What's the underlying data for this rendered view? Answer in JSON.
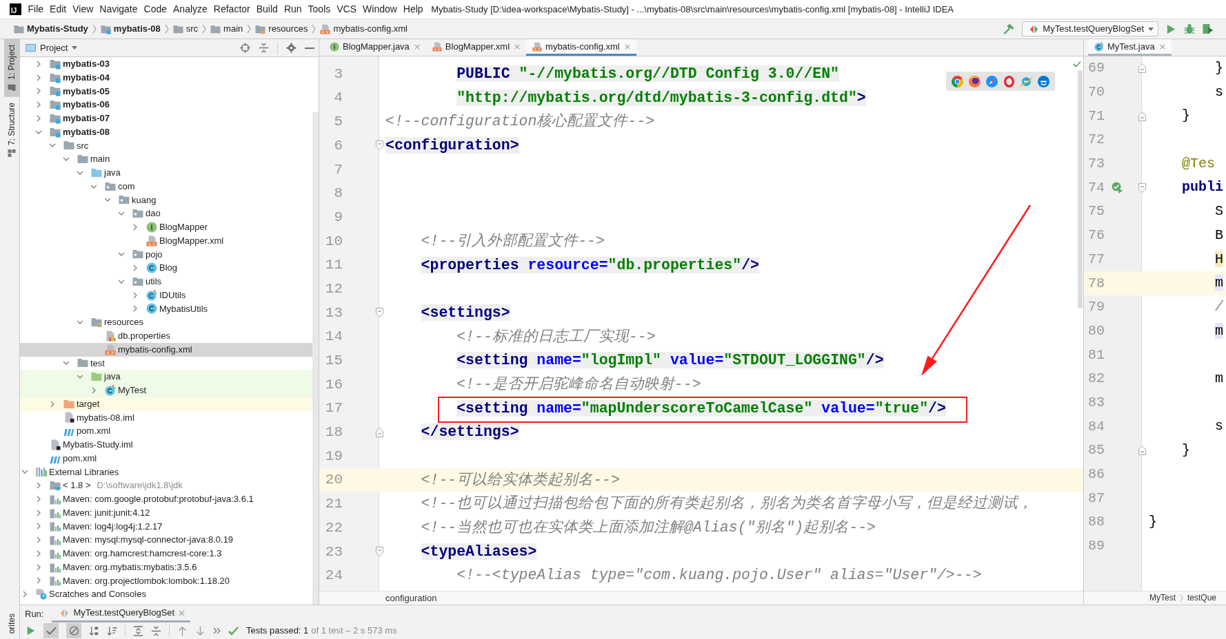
{
  "menu_bar": {
    "logo": "IJ",
    "items": [
      "File",
      "Edit",
      "View",
      "Navigate",
      "Code",
      "Analyze",
      "Refactor",
      "Build",
      "Run",
      "Tools",
      "VCS",
      "Window",
      "Help"
    ],
    "title": "Mybatis-Study [D:\\idea-workspace\\Mybatis-Study] - ...\\mybatis-08\\src\\main\\resources\\mybatis-config.xml [mybatis-08] - IntelliJ IDEA"
  },
  "navigation_bar": {
    "crumbs": [
      {
        "label": "Mybatis-Study",
        "kind": "project"
      },
      {
        "label": "mybatis-08",
        "kind": "module"
      },
      {
        "label": "src",
        "kind": "folder"
      },
      {
        "label": "main",
        "kind": "folder"
      },
      {
        "label": "resources",
        "kind": "resources"
      },
      {
        "label": "mybatis-config.xml",
        "kind": "xml"
      }
    ],
    "run_config": "MyTest.testQueryBlogSet"
  },
  "tool_stripe": {
    "tabs": [
      {
        "label": "1: Project",
        "kind": "project",
        "selected": true
      },
      {
        "label": "7: Structure",
        "kind": "structure",
        "selected": false
      }
    ],
    "bottom_tabs": [
      {
        "label": "orites",
        "selected": false
      }
    ]
  },
  "project_panel": {
    "title": "Project",
    "tree": {
      "project_children": [
        {
          "label": "mybatis-03",
          "kind": "module",
          "expanded": false,
          "selected": false
        },
        {
          "label": "mybatis-04",
          "kind": "module",
          "expanded": false,
          "selected": false
        },
        {
          "label": "mybatis-05",
          "kind": "module",
          "expanded": false,
          "selected": false
        },
        {
          "label": "mybatis-06",
          "kind": "module",
          "expanded": false,
          "selected": false
        },
        {
          "label": "mybatis-07",
          "kind": "module",
          "expanded": false,
          "selected": false
        },
        {
          "label": "mybatis-08",
          "kind": "module",
          "expanded": true,
          "selected": false,
          "children": [
            {
              "label": "src",
              "kind": "folder",
              "expanded": true,
              "selected": false,
              "children": [
                {
                  "label": "main",
                  "kind": "folder",
                  "expanded": true,
                  "selected": false,
                  "children": [
                    {
                      "label": "java",
                      "kind": "source_root",
                      "expanded": true,
                      "selected": false,
                      "children": [
                        {
                          "label": "com",
                          "kind": "package",
                          "expanded": true,
                          "selected": false,
                          "children": [
                            {
                              "label": "kuang",
                              "kind": "package",
                              "expanded": true,
                              "selected": false,
                              "children": [
                                {
                                  "label": "dao",
                                  "kind": "package",
                                  "expanded": true,
                                  "selected": false,
                                  "children": [
                                    {
                                      "label": "BlogMapper",
                                      "kind": "interface",
                                      "expanded": false,
                                      "selected": false
                                    },
                                    {
                                      "label": "BlogMapper.xml",
                                      "kind": "xml",
                                      "selected": false
                                    }
                                  ]
                                },
                                {
                                  "label": "pojo",
                                  "kind": "package",
                                  "expanded": true,
                                  "selected": false,
                                  "children": [
                                    {
                                      "label": "Blog",
                                      "kind": "class",
                                      "expanded": false,
                                      "selected": false
                                    }
                                  ]
                                },
                                {
                                  "label": "utils",
                                  "kind": "package",
                                  "expanded": true,
                                  "selected": false,
                                  "children": [
                                    {
                                      "label": "IDUtils",
                                      "kind": "class_mod",
                                      "expanded": false,
                                      "selected": false
                                    },
                                    {
                                      "label": "MybatisUtils",
                                      "kind": "class",
                                      "expanded": false,
                                      "selected": false
                                    }
                                  ]
                                }
                              ]
                            }
                          ]
                        }
                      ]
                    },
                    {
                      "label": "resources",
                      "kind": "resources",
                      "expanded": true,
                      "selected": false,
                      "children": [
                        {
                          "label": "db.properties",
                          "kind": "properties",
                          "selected": false
                        },
                        {
                          "label": "mybatis-config.xml",
                          "kind": "xml",
                          "selected": true
                        }
                      ]
                    }
                  ]
                },
                {
                  "label": "test",
                  "kind": "folder",
                  "expanded": true,
                  "selected": false,
                  "children": [
                    {
                      "label": "java",
                      "kind": "test_root",
                      "expanded": true,
                      "selected": false,
                      "children": [
                        {
                          "label": "MyTest",
                          "kind": "class_mod",
                          "expanded": false,
                          "selected": false
                        }
                      ]
                    }
                  ]
                }
              ]
            },
            {
              "label": "target",
              "kind": "excluded",
              "expanded": false,
              "selected": false
            },
            {
              "label": "mybatis-08.iml",
              "kind": "iml",
              "selected": false
            },
            {
              "label": "pom.xml",
              "kind": "maven",
              "selected": false
            }
          ]
        },
        {
          "label": "Mybatis-Study.iml",
          "kind": "iml",
          "selected": false
        },
        {
          "label": "pom.xml",
          "kind": "maven",
          "selected": false
        }
      ],
      "roots": [
        {
          "label": "External Libraries",
          "kind": "libraries",
          "expanded": true,
          "selected": false,
          "children": [
            {
              "label": "< 1.8 >",
              "detail": "D:\\software\\jdk1.8\\jdk",
              "kind": "jdk",
              "expanded": false,
              "selected": false
            },
            {
              "label": "Maven: com.google.protobuf:protobuf-java:3.6.1",
              "kind": "library",
              "expanded": false,
              "selected": false
            },
            {
              "label": "Maven: junit:junit:4.12",
              "kind": "library",
              "expanded": false,
              "selected": false
            },
            {
              "label": "Maven: log4j:log4j:1.2.17",
              "kind": "library",
              "expanded": false,
              "selected": false
            },
            {
              "label": "Maven: mysql:mysql-connector-java:8.0.19",
              "kind": "library",
              "expanded": false,
              "selected": false
            },
            {
              "label": "Maven: org.hamcrest:hamcrest-core:1.3",
              "kind": "library",
              "expanded": false,
              "selected": false
            },
            {
              "label": "Maven: org.mybatis:mybatis:3.5.6",
              "kind": "library",
              "expanded": false,
              "selected": false
            },
            {
              "label": "Maven: org.projectlombok:lombok:1.18.20",
              "kind": "library",
              "expanded": false,
              "selected": false
            }
          ]
        },
        {
          "label": "Scratches and Consoles",
          "kind": "scratches",
          "expanded": false,
          "selected": false
        }
      ]
    }
  },
  "editor": {
    "focused": true,
    "arrow": true,
    "tabs": [
      {
        "label": "BlogMapper.java",
        "kind": "interface",
        "selected": false
      },
      {
        "label": "BlogMapper.xml",
        "kind": "xml",
        "selected": false
      },
      {
        "label": "mybatis-config.xml",
        "kind": "xml",
        "selected": true
      }
    ],
    "lines": [
      {
        "number": "3",
        "tokens": [
          {
            "kind": "doctype",
            "text": "        PUBLIC"
          },
          {
            "kind": "value",
            "text": " \"-//mybatis.org//DTD Config 3.0//EN\""
          }
        ],
        "current": false,
        "boxed": false
      },
      {
        "number": "4",
        "tokens": [
          {
            "kind": "value",
            "text": "        \"http://mybatis.org/dtd/mybatis-3-config.dtd\""
          },
          {
            "kind": "tag",
            "text": ">"
          }
        ],
        "current": false,
        "boxed": false
      },
      {
        "number": "5",
        "tokens": [
          {
            "kind": "comment",
            "text": "<!--configuration核心配置文件-->"
          }
        ],
        "current": false,
        "boxed": false
      },
      {
        "number": "6",
        "tokens": [
          {
            "kind": "tag",
            "text": "<configuration>"
          }
        ],
        "gutter": [
          {
            "kind": "fold_start"
          }
        ],
        "current": false,
        "boxed": false
      },
      {
        "number": "7",
        "current": false,
        "boxed": false
      },
      {
        "number": "8",
        "current": false,
        "boxed": false
      },
      {
        "number": "9",
        "current": false,
        "boxed": false
      },
      {
        "number": "10",
        "tokens": [
          {
            "kind": "comment",
            "text": "    <!--引入外部配置文件-->"
          }
        ],
        "current": false,
        "boxed": false
      },
      {
        "number": "11",
        "tokens": [
          {
            "kind": "tag",
            "text": "    <properties"
          },
          {
            "kind": "attr",
            "text": " resource="
          },
          {
            "kind": "value",
            "text": "\"db.properties\""
          },
          {
            "kind": "tag",
            "text": "/>"
          }
        ],
        "current": false,
        "boxed": false
      },
      {
        "number": "12",
        "current": false,
        "boxed": false
      },
      {
        "number": "13",
        "tokens": [
          {
            "kind": "tag",
            "text": "    <settings>"
          }
        ],
        "gutter": [
          {
            "kind": "fold_start"
          }
        ],
        "current": false,
        "boxed": false
      },
      {
        "number": "14",
        "tokens": [
          {
            "kind": "comment",
            "text": "        <!--标准的日志工厂实现-->"
          }
        ],
        "current": false,
        "boxed": false
      },
      {
        "number": "15",
        "tokens": [
          {
            "kind": "tag",
            "text": "        <setting"
          },
          {
            "kind": "attr",
            "text": " name="
          },
          {
            "kind": "value",
            "text": "\"logImpl\""
          },
          {
            "kind": "attr",
            "text": " value="
          },
          {
            "kind": "value",
            "text": "\"STDOUT_LOGGING\""
          },
          {
            "kind": "tag",
            "text": "/>"
          }
        ],
        "current": false,
        "boxed": false
      },
      {
        "number": "16",
        "tokens": [
          {
            "kind": "comment",
            "text": "        <!--是否开启驼峰命名自动映射-->"
          }
        ],
        "current": false,
        "boxed": false
      },
      {
        "number": "17",
        "tokens": [
          {
            "kind": "tag",
            "text": "        <setting"
          },
          {
            "kind": "attr",
            "text": " name="
          },
          {
            "kind": "value",
            "text": "\"mapUnderscoreToCamelCase\""
          },
          {
            "kind": "attr",
            "text": " value="
          },
          {
            "kind": "value",
            "text": "\"true\""
          },
          {
            "kind": "tag",
            "text": "/>"
          }
        ],
        "current": false,
        "boxed": true
      },
      {
        "number": "18",
        "tokens": [
          {
            "kind": "tag",
            "text": "    </settings>"
          }
        ],
        "gutter": [
          {
            "kind": "fold_end"
          }
        ],
        "current": false,
        "boxed": false
      },
      {
        "number": "19",
        "current": false,
        "boxed": false
      },
      {
        "number": "20",
        "tokens": [
          {
            "kind": "comment",
            "text": "    <!--可以给实体类起别名-->"
          }
        ],
        "current": true,
        "boxed": false
      },
      {
        "number": "21",
        "tokens": [
          {
            "kind": "comment",
            "text": "    <!--也可以通过扫描包给包下面的所有类起别名，别名为类名首字母小写，但是经过测试，"
          }
        ],
        "current": false,
        "boxed": false
      },
      {
        "number": "22",
        "tokens": [
          {
            "kind": "comment",
            "text": "    <!--当然也可也在实体类上面添加注解@Alias(\"别名\")起别名-->"
          }
        ],
        "current": false,
        "boxed": false
      },
      {
        "number": "23",
        "tokens": [
          {
            "kind": "tag",
            "text": "    <typeAliases>"
          }
        ],
        "gutter": [
          {
            "kind": "fold_start"
          }
        ],
        "current": false,
        "boxed": false
      },
      {
        "number": "24",
        "tokens": [
          {
            "kind": "comment",
            "text": "        <!--<typeAlias type=\"com.kuang.pojo.User\" alias=\"User\"/>-->"
          }
        ],
        "current": false,
        "boxed": false
      }
    ],
    "breadcrumbs": [
      "configuration"
    ]
  },
  "side_editor": {
    "focused": false,
    "tabs": [
      {
        "label": "MyTest.java",
        "kind": "class_mod",
        "selected": true
      }
    ],
    "lines": [
      {
        "number": "69",
        "tokens": [
          {
            "kind": "plain",
            "text": "        }"
          }
        ],
        "gutter": [
          {
            "kind": "fold_end"
          }
        ],
        "current": false
      },
      {
        "number": "70",
        "tokens": [
          {
            "kind": "plain",
            "text": "        s"
          }
        ],
        "current": false
      },
      {
        "number": "71",
        "tokens": [
          {
            "kind": "plain",
            "text": "    }"
          }
        ],
        "gutter": [
          {
            "kind": "fold_end"
          }
        ],
        "current": false
      },
      {
        "number": "72",
        "current": false
      },
      {
        "number": "73",
        "tokens": [
          {
            "kind": "annotation",
            "text": "    @Tes"
          }
        ],
        "current": false
      },
      {
        "number": "74",
        "tokens": [
          {
            "kind": "keyword",
            "text": "    publi"
          }
        ],
        "gutter": [
          {
            "kind": "test_passed"
          },
          {
            "kind": "fold_start"
          }
        ],
        "current": false
      },
      {
        "number": "75",
        "tokens": [
          {
            "kind": "plain",
            "text": "        S"
          }
        ],
        "current": false
      },
      {
        "number": "76",
        "tokens": [
          {
            "kind": "plain",
            "text": "        B"
          }
        ],
        "current": false
      },
      {
        "number": "77",
        "tokens": [
          {
            "kind": "warning",
            "text": "        H"
          }
        ],
        "current": false
      },
      {
        "number": "78",
        "tokens": [
          {
            "kind": "usage",
            "text": "        m"
          }
        ],
        "current": true
      },
      {
        "number": "79",
        "tokens": [
          {
            "kind": "comment",
            "text": "        /"
          }
        ],
        "current": false
      },
      {
        "number": "80",
        "tokens": [
          {
            "kind": "usage",
            "text": "        m"
          }
        ],
        "current": false
      },
      {
        "number": "81",
        "current": false
      },
      {
        "number": "82",
        "tokens": [
          {
            "kind": "plain",
            "text": "        m"
          }
        ],
        "current": false
      },
      {
        "number": "83",
        "current": false
      },
      {
        "number": "84",
        "tokens": [
          {
            "kind": "plain",
            "text": "        s"
          }
        ],
        "current": false
      },
      {
        "number": "85",
        "tokens": [
          {
            "kind": "plain",
            "text": "    }"
          }
        ],
        "gutter": [
          {
            "kind": "fold_end"
          }
        ],
        "current": false
      },
      {
        "number": "86",
        "current": false
      },
      {
        "number": "87",
        "current": false
      },
      {
        "number": "88",
        "tokens": [
          {
            "kind": "plain",
            "text": "}"
          }
        ],
        "current": false
      },
      {
        "number": "89",
        "current": false
      }
    ],
    "breadcrumbs": [
      "MyTest",
      "testQue"
    ]
  },
  "run_panel": {
    "label": "Run:",
    "tab": {
      "label": "MyTest.testQueryBlogSet",
      "selected": true
    },
    "toggles": [
      {
        "kind": "show_passed",
        "selected": true
      },
      {
        "kind": "show_ignored",
        "selected": true
      }
    ],
    "status": {
      "summary": "Tests passed: 1",
      "detail": "of 1 test – 2 s 573 ms"
    }
  }
}
